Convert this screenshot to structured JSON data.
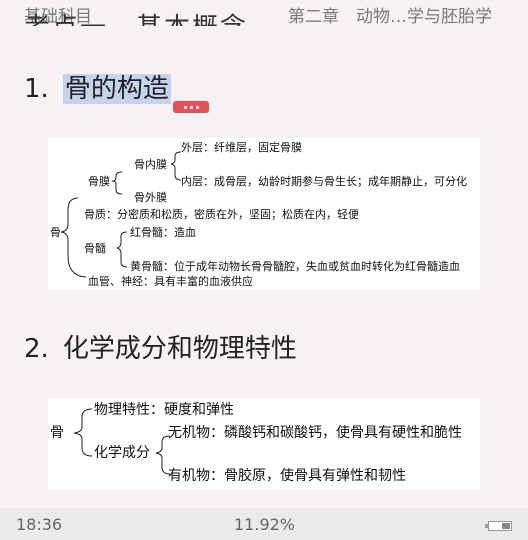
{
  "header": {
    "left": "基础科目",
    "right": "第二章　动物…学与胚胎学"
  },
  "cut_heading": "考点一、基本概念",
  "section1": {
    "number": "1.",
    "title": "骨的构造"
  },
  "diagram1": {
    "root": "骨",
    "gumo": "骨膜",
    "gunei": "骨内膜",
    "waiceng": "外层：纤维层，固定骨膜",
    "neiceng": "内层：成骨层，幼龄时期参与骨生长；成年期静止，可分化",
    "guwai": "骨外膜",
    "guzhi": "骨质：分密质和松质，密质在外，坚固；松质在内，轻便",
    "gusui": "骨髓",
    "hong": "红骨髓：造血",
    "huang": "黄骨髓：位于成年动物长骨骨髓腔，失血或贫血时转化为红骨髓造血",
    "xueguan": "血管、神经：具有丰富的血液供应"
  },
  "section2": {
    "number": "2.",
    "title": "化学成分和物理特性"
  },
  "diagram2": {
    "root": "骨",
    "wuli": "物理特性：硬度和弹性",
    "huaxue": "化学成分",
    "wuji": "无机物：磷酸钙和碳酸钙，使骨具有硬性和脆性",
    "youji": "有机物：骨胶原，使骨具有弹性和韧性"
  },
  "footer": {
    "time": "18:36",
    "progress": "11.92%",
    "battery_level": 0.4
  }
}
